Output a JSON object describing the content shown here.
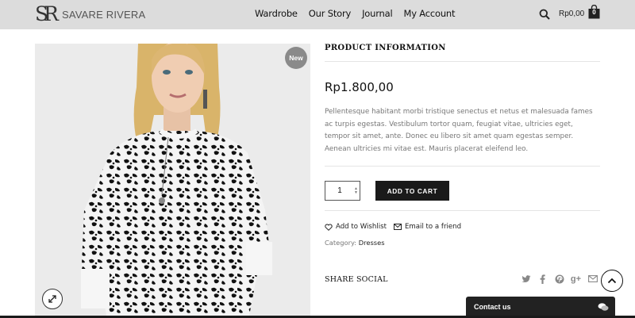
{
  "header": {
    "logo_mark": "SR",
    "brand": "SAVARE RIVERA",
    "nav": [
      "Wardrobe",
      "Our Story",
      "Journal",
      "My Account"
    ],
    "cart_total": "Rp0,00",
    "cart_count": "0",
    "icons": {
      "search": "search-icon",
      "cart": "shopping-bag-icon"
    }
  },
  "product": {
    "badge": "New",
    "image_desc_icon": "product-photo",
    "heading": "PRODUCT INFORMATION",
    "price": "Rp1.800,00",
    "description": "Pellentesque habitant morbi tristique senectus et netus et malesuada fames ac turpis egestas. Vestibulum tortor quam, feugiat vitae, ultricies eget, tempor sit amet, ante. Donec eu libero sit amet quam egestas semper. Aenean ultricies mi vitae est. Mauris placerat eleifend leo.",
    "quantity": "1",
    "add_to_cart": "ADD TO CART",
    "wishlist": "Add to Wishlist",
    "email_friend": "Email to a friend",
    "category_label": "Category:",
    "category_value": "Dresses",
    "share_title": "SHARE SOCIAL",
    "share_icons": [
      "twitter-icon",
      "facebook-icon",
      "pinterest-icon",
      "google-plus-icon",
      "mail-icon"
    ]
  },
  "floating": {
    "contact_label": "Contact us",
    "back_to_top_icon": "chevron-up-icon"
  },
  "colors": {
    "header_bg": "#dcdcdc",
    "button_bg": "#1a1a1a",
    "badge_bg": "#8a8a8a",
    "text_muted": "#777777"
  }
}
